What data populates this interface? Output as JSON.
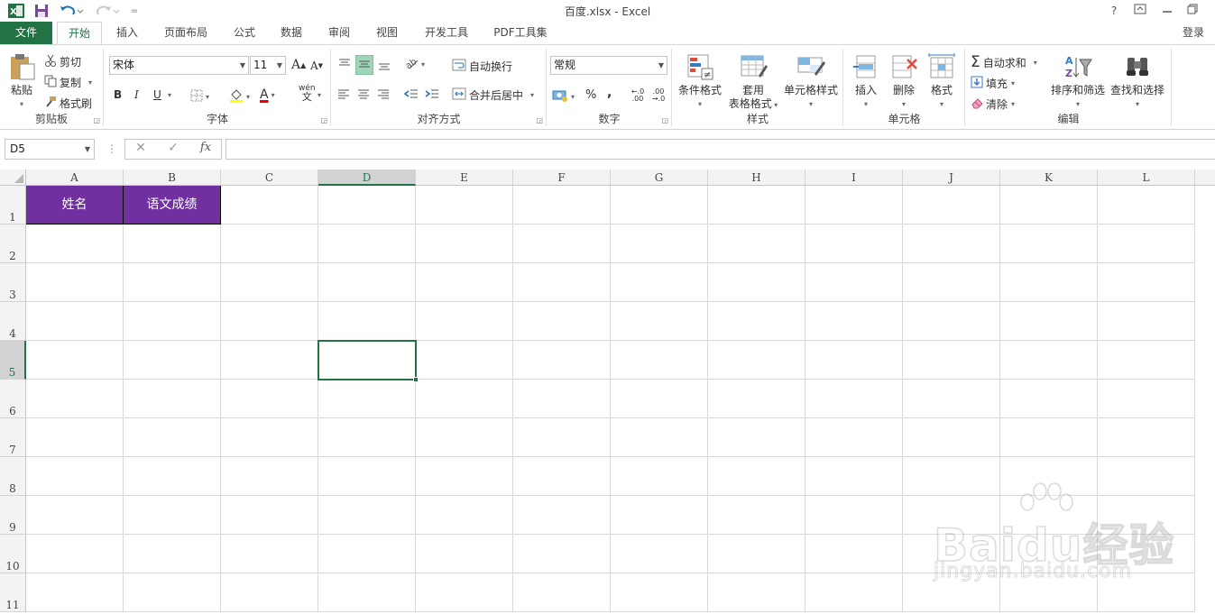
{
  "window": {
    "title": "百度.xlsx - Excel",
    "help": "?",
    "qat_more": "="
  },
  "tabs": {
    "file": "文件",
    "items": [
      "开始",
      "插入",
      "页面布局",
      "公式",
      "数据",
      "审阅",
      "视图",
      "开发工具",
      "PDF工具集"
    ],
    "active": "开始",
    "login": "登录"
  },
  "ribbon": {
    "clipboard": {
      "label": "剪贴板",
      "paste": "粘贴",
      "cut": "剪切",
      "copy": "复制",
      "format_painter": "格式刷"
    },
    "font": {
      "label": "字体",
      "font_name": "宋体",
      "font_size": "11",
      "grow": "A",
      "shrink": "A",
      "bold": "B",
      "italic": "I",
      "underline": "U",
      "font_color_letter": "A",
      "phonetic": "wén"
    },
    "alignment": {
      "label": "对齐方式",
      "wrap_text": "自动换行",
      "merge_center": "合并后居中"
    },
    "number": {
      "label": "数字",
      "format": "常规",
      "percent": "%",
      "comma": ",",
      "inc_decimal": "←.0 .00",
      "dec_decimal": ".00 →.0"
    },
    "styles": {
      "label": "样式",
      "conditional": "条件格式",
      "table_format_1": "套用",
      "table_format_2": "表格格式",
      "cell_styles": "单元格样式"
    },
    "cells": {
      "label": "单元格",
      "insert": "插入",
      "delete": "删除",
      "format": "格式"
    },
    "editing": {
      "label": "编辑",
      "autosum": "自动求和",
      "fill": "填充",
      "clear": "清除",
      "sort_filter": "排序和筛选",
      "find_select": "查找和选择"
    }
  },
  "formula_bar": {
    "name_box": "D5",
    "cancel": "✕",
    "enter": "✓",
    "fx": "fx",
    "content": ""
  },
  "sheet": {
    "columns": [
      "A",
      "B",
      "C",
      "D",
      "E",
      "F",
      "G",
      "H",
      "I",
      "J",
      "K",
      "L"
    ],
    "rows": [
      "1",
      "2",
      "3",
      "4",
      "5",
      "6",
      "7",
      "8",
      "9",
      "10",
      "11"
    ],
    "selected_col": "D",
    "selected_row": "5",
    "cells": {
      "A1": "姓名",
      "B1": "语文成绩"
    },
    "header_fill": "#7030a0",
    "accent": "#217346"
  },
  "watermark": {
    "brand": "Baidu经验",
    "url": "jingyan.baidu.com"
  }
}
